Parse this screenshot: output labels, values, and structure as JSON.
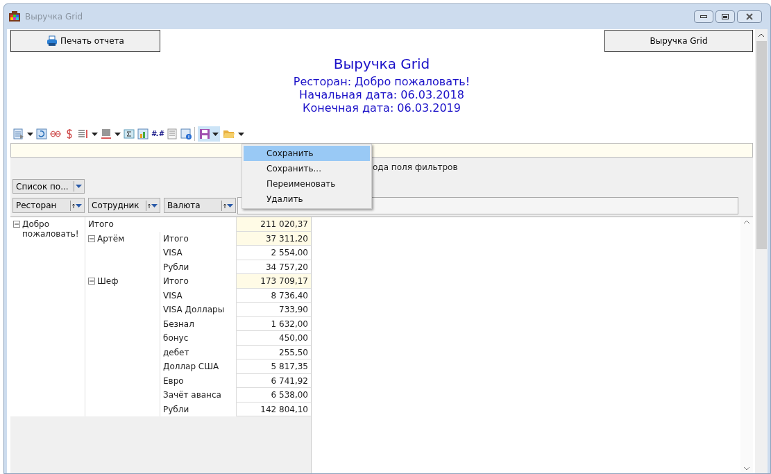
{
  "window": {
    "title": "Выручка Grid"
  },
  "buttons": {
    "print": "Печать отчета",
    "grid": "Выручка Grid"
  },
  "report": {
    "title": "Выручка Grid",
    "lines": [
      "Ресторан: Добро пожаловать!",
      "Начальная дата: 06.03.2018",
      "Конечная дата: 06.03.2019"
    ]
  },
  "toolbar": {
    "number_format": "#.#",
    "save_open": true
  },
  "save_menu": [
    {
      "label": "Сохранить",
      "selected": true
    },
    {
      "label": "Сохранить...",
      "selected": false
    },
    {
      "label": "Переименовать",
      "selected": false
    },
    {
      "label": "Удалить",
      "selected": false
    }
  ],
  "pivot": {
    "filter_hint": "ода поля фильтров",
    "field_list": "Список по...",
    "row_fields": [
      "Ресторан",
      "Сотрудник",
      "Валюта"
    ],
    "rows": [
      {
        "label": "Добро пожаловать!",
        "expanded": true,
        "total_label": "Итого",
        "total": "211 020,37",
        "children": [
          {
            "label": "Артём",
            "expanded": true,
            "children": [
              {
                "label": "Итого",
                "value": "37 311,20",
                "kind": "total"
              },
              {
                "label": "VISA",
                "value": "2 554,00",
                "kind": "value"
              },
              {
                "label": "Рубли",
                "value": "34 757,20",
                "kind": "value"
              }
            ]
          },
          {
            "label": "Шеф",
            "expanded": true,
            "children": [
              {
                "label": "Итого",
                "value": "173 709,17",
                "kind": "total"
              },
              {
                "label": "VISA",
                "value": "8 736,40",
                "kind": "value"
              },
              {
                "label": "VISA Доллары",
                "value": "733,90",
                "kind": "value"
              },
              {
                "label": "Безнал",
                "value": "1 632,00",
                "kind": "value"
              },
              {
                "label": "бонус",
                "value": "450,00",
                "kind": "value"
              },
              {
                "label": "дебет",
                "value": "255,50",
                "kind": "value"
              },
              {
                "label": "Доллар США",
                "value": "5 817,35",
                "kind": "value"
              },
              {
                "label": "Евро",
                "value": "6 741,92",
                "kind": "value"
              },
              {
                "label": "Зачёт аванса",
                "value": "6 538,00",
                "kind": "value"
              },
              {
                "label": "Рубли",
                "value": "142 804,10",
                "kind": "value"
              }
            ]
          }
        ]
      }
    ]
  }
}
